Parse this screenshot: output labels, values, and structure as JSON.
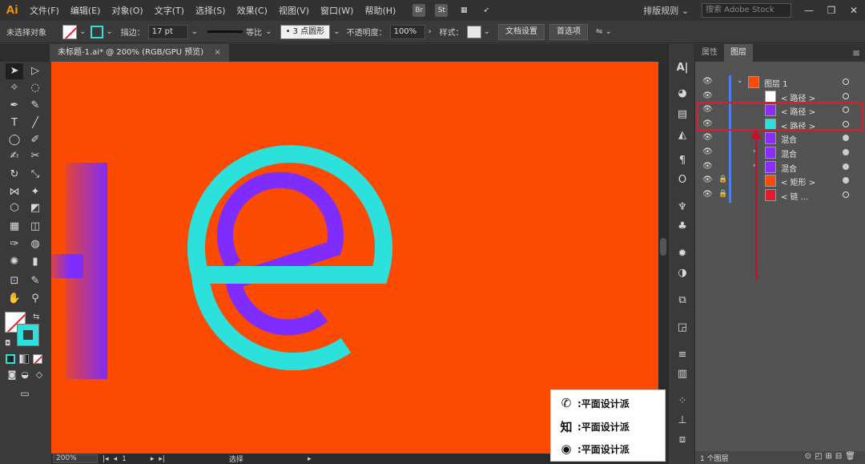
{
  "app": {
    "logo": "Ai"
  },
  "menu": [
    "文件(F)",
    "编辑(E)",
    "对象(O)",
    "文字(T)",
    "选择(S)",
    "效果(C)",
    "视图(V)",
    "窗口(W)",
    "帮助(H)"
  ],
  "menubar_icons": {
    "bridge": "Br",
    "stock": "St",
    "arrange": "▦",
    "gpu": "➶"
  },
  "workspace": "排版规则 ⌄",
  "stock_search": {
    "placeholder": "搜索 Adobe Stock"
  },
  "window_buttons": {
    "min": "—",
    "max": "❐",
    "close": "✕"
  },
  "control": {
    "selection": "未选择对象",
    "stroke_label": "描边：",
    "stroke_value": "17 pt",
    "stroke_profile": "等比",
    "brush": "• 3 点圆形",
    "opacity_label": "不透明度：",
    "opacity_value": "100%",
    "style_label": "样式：",
    "doc_setup": "文档设置",
    "preferences": "首选项"
  },
  "doc_tab": {
    "title": "未标题-1.ai* @ 200% (RGB/GPU 预览)",
    "close": "×"
  },
  "status": {
    "zoom": "200%",
    "artboard": "1",
    "tool": "选择"
  },
  "layers_panel": {
    "tabs": [
      "属性",
      "图层"
    ],
    "rows": [
      {
        "label": "图层 1",
        "level": 0,
        "lock": false,
        "expand": "⌄",
        "thumb": "#fb4a02",
        "filled": false
      },
      {
        "label": "< 路径 >",
        "level": 1,
        "lock": false,
        "expand": "",
        "thumb": "#ffffff",
        "filled": false
      },
      {
        "label": "< 路径 >",
        "level": 1,
        "lock": false,
        "expand": "",
        "thumb": "#8b2cff",
        "filled": false
      },
      {
        "label": "< 路径 >",
        "level": 1,
        "lock": false,
        "expand": "",
        "thumb": "#2ce1dc",
        "filled": false
      },
      {
        "label": "混合",
        "level": 1,
        "lock": false,
        "expand": "›",
        "thumb": "#8b2cff",
        "filled": true
      },
      {
        "label": "混合",
        "level": 1,
        "lock": false,
        "expand": "›",
        "thumb": "#8b2cff",
        "filled": true
      },
      {
        "label": "混合",
        "level": 1,
        "lock": false,
        "expand": "›",
        "thumb": "#8b2cff",
        "filled": true
      },
      {
        "label": "< 矩形 >",
        "level": 1,
        "lock": true,
        "expand": "",
        "thumb": "#fb4a02",
        "filled": true
      },
      {
        "label": "< 链 ... ",
        "level": 1,
        "lock": true,
        "expand": "",
        "thumb": "#e21b2c",
        "filled": false
      }
    ],
    "footer_count": "1 个图层"
  },
  "watermark": [
    {
      "icon": "wechat-icon",
      "glyph": "✆",
      "text": ":平面设计派"
    },
    {
      "icon": "zhihu-icon",
      "glyph": "知",
      "text": ":平面设计派"
    },
    {
      "icon": "weibo-icon",
      "glyph": "◉",
      "text": ":平面设计派"
    }
  ],
  "colors": {
    "canvas_bg": "#fb4a02",
    "cyan": "#2ce1dc",
    "purple": "#7f2cff",
    "highlight": "#e21b2c"
  }
}
